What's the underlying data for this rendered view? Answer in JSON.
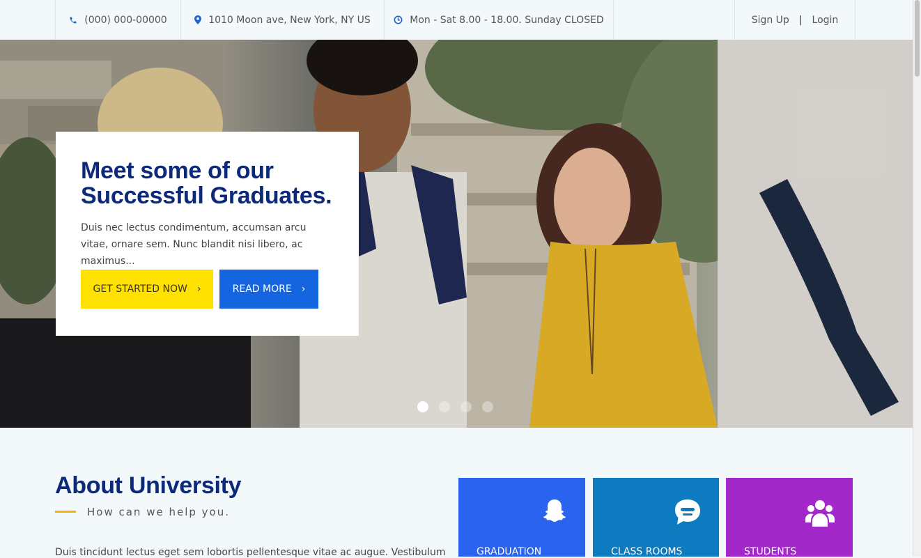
{
  "topbar": {
    "phone": "(000) 000-00000",
    "address": "1010 Moon ave, New York, NY US",
    "hours": "Mon - Sat 8.00 - 18.00. Sunday CLOSED",
    "signup": "Sign Up",
    "separator": "|",
    "login": "Login",
    "icons": [
      "phone-icon",
      "map-marker-icon",
      "clock-icon"
    ]
  },
  "hero": {
    "title": "Meet some of our Successful Graduates.",
    "text": "Duis nec lectus condimentum, accumsan arcu vitae, ornare sem. Nunc blandit nisi libero, ac maximus...",
    "button_start": "GET STARTED NOW",
    "button_more": "READ MORE",
    "slides_count": 4,
    "active_slide": 1
  },
  "about": {
    "title": "About University",
    "subtitle": "How can we help you.",
    "text": "Duis tincidunt lectus eget sem lobortis pellentesque vitae ac augue. Vestibulum"
  },
  "tiles": [
    {
      "label": "GRADUATION",
      "icon": "snapchat-ghost-icon",
      "color": "#2a63ee"
    },
    {
      "label": "CLASS ROOMS",
      "icon": "chat-face-icon",
      "color": "#0e7bc0"
    },
    {
      "label": "STUDENTS",
      "icon": "users-group-icon",
      "color": "#a328c9"
    }
  ],
  "colors": {
    "brand_navy": "#0d2a7a",
    "accent_yellow": "#ffe100",
    "accent_blue": "#1565e1",
    "underline": "#f5b400"
  }
}
